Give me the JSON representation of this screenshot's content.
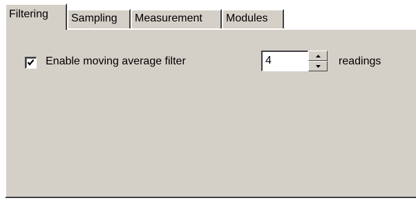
{
  "tabs": [
    {
      "label": "Filtering",
      "active": true
    },
    {
      "label": "Sampling",
      "active": false
    },
    {
      "label": "Measurement",
      "active": false
    },
    {
      "label": "Modules",
      "active": false
    }
  ],
  "filtering": {
    "moving_average_checkbox": {
      "label": "Enable moving average filter",
      "checked": true,
      "icon": "checkmark-icon"
    },
    "readings_count": {
      "value": "4",
      "unit_label": "readings",
      "up_icon": "arrow-up-icon",
      "down_icon": "arrow-down-icon"
    }
  },
  "colors": {
    "dialog_face": "#d4d0c8",
    "highlight": "#ffffff",
    "shadow": "#404040",
    "text": "#000000"
  }
}
